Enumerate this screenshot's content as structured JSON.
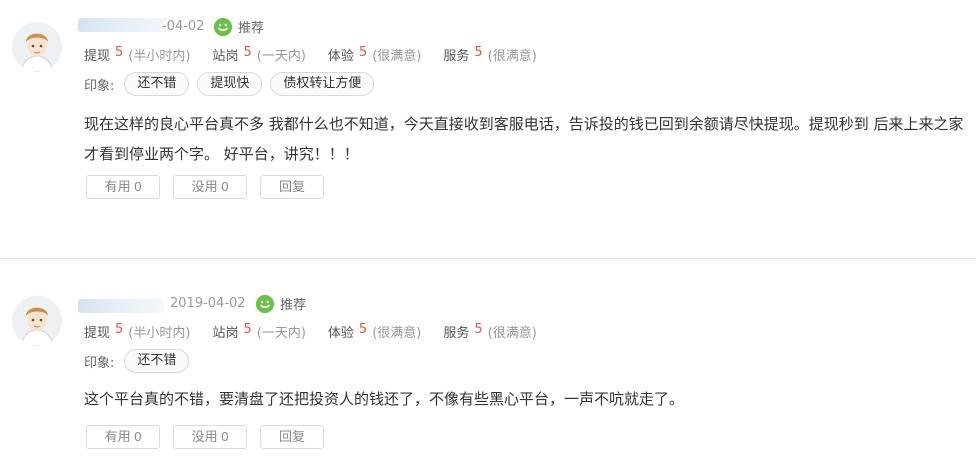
{
  "reviews": [
    {
      "date": "-04-02",
      "recommend_label": "推荐",
      "ratings": [
        {
          "label": "提现",
          "score": "5",
          "desc": "(半小时内)"
        },
        {
          "label": "站岗",
          "score": "5",
          "desc": "(一天内)"
        },
        {
          "label": "体验",
          "score": "5",
          "desc": "(很满意)"
        },
        {
          "label": "服务",
          "score": "5",
          "desc": "(很满意)"
        }
      ],
      "impressions_label": "印象:",
      "tags": [
        "还不错",
        "提现快",
        "债权转让方便"
      ],
      "content": "现在这样的良心平台真不多 我都什么也不知道，今天直接收到客服电话，告诉投的钱已回到余额请尽快提现。提现秒到 后来上来之家才看到停业两个字。 好平台，讲究！！！",
      "useful": "有用 0",
      "useless": "没用 0",
      "reply": "回复"
    },
    {
      "date": "2019-04-02",
      "recommend_label": "推荐",
      "ratings": [
        {
          "label": "提现",
          "score": "5",
          "desc": "(半小时内)"
        },
        {
          "label": "站岗",
          "score": "5",
          "desc": "(一天内)"
        },
        {
          "label": "体验",
          "score": "5",
          "desc": "(很满意)"
        },
        {
          "label": "服务",
          "score": "5",
          "desc": "(很满意)"
        }
      ],
      "impressions_label": "印象:",
      "tags": [
        "还不错"
      ],
      "content": "这个平台真的不错，要清盘了还把投资人的钱还了，不像有些黑心平台，一声不吭就走了。",
      "useful": "有用 0",
      "useless": "没用 0",
      "reply": "回复"
    }
  ],
  "colors": {
    "score": "#e4553f",
    "recommend_icon": "#6cc04a",
    "muted": "#999999"
  },
  "icons": {
    "avatar": "user-avatar-icon",
    "recommend": "smile-icon"
  }
}
